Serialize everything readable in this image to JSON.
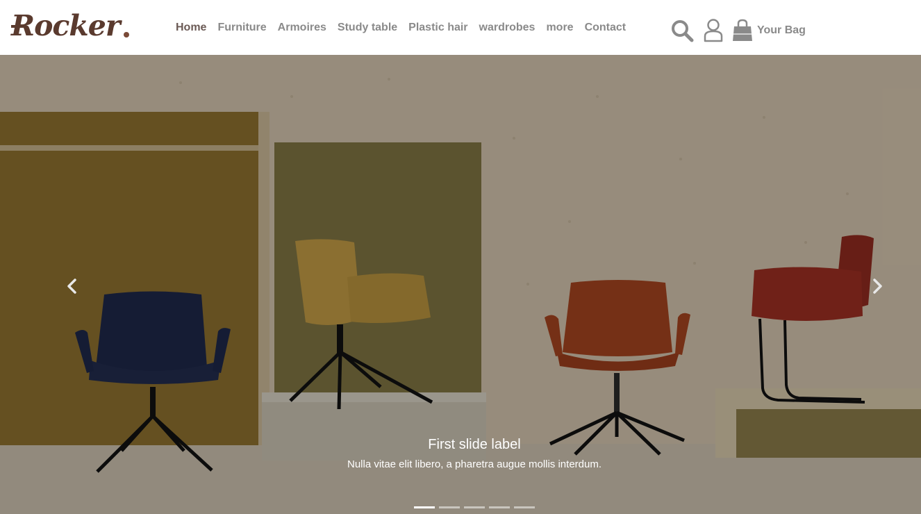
{
  "brand": {
    "name": "Rocker",
    "color": "#5a3a2e"
  },
  "nav": {
    "items": [
      {
        "label": "Home",
        "active": true
      },
      {
        "label": "Furniture"
      },
      {
        "label": "Armoires"
      },
      {
        "label": "Study table"
      },
      {
        "label": "Plastic hair"
      },
      {
        "label": "wardrobes"
      },
      {
        "label": "more"
      },
      {
        "label": "Contact"
      }
    ]
  },
  "tools": {
    "search_icon": "search-icon",
    "user_icon": "user-icon",
    "bag_icon": "shopping-bag-icon",
    "bag_label": "Your Bag"
  },
  "carousel": {
    "prev_icon": "chevron-left-icon",
    "next_icon": "chevron-right-icon",
    "slide": {
      "title": "First slide label",
      "text": "Nulla vitae elit libero, a pharetra augue mollis interdum."
    },
    "slide_count": 5,
    "active_index": 0
  }
}
